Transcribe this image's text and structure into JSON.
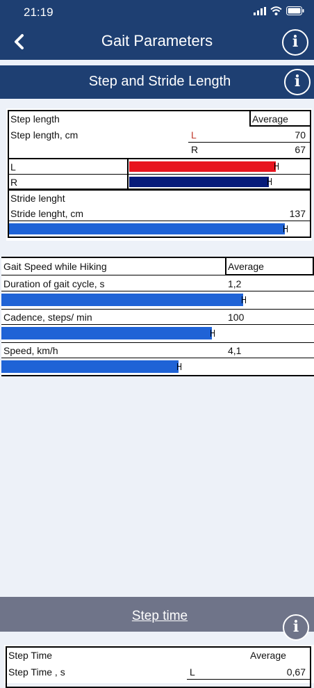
{
  "status_bar": {
    "time": "21:19"
  },
  "nav": {
    "title": "Gait Parameters"
  },
  "section": {
    "title": "Step and Stride Length"
  },
  "step_table": {
    "title": "Step length",
    "average_label": "Average",
    "unit_label": "Step length, cm",
    "left_label": "L",
    "right_label": "R",
    "left_value": "70",
    "right_value": "67",
    "left_bar_fill": 0.511,
    "right_bar_fill": 0.489,
    "left_color": "#e8141f",
    "right_color": "#071b7a"
  },
  "stride_table": {
    "title": "Stride lenght",
    "unit_label": "Stride lenght, cm",
    "value": "137",
    "bar_fill": 1.0
  },
  "gait_table": {
    "title": "Gait Speed while Hiking",
    "average_label": "Average",
    "rows": [
      {
        "label": "Duration of gait cycle, s",
        "value": "1,2",
        "bar_fill": 1.0
      },
      {
        "label": "Cadence, steps/ min",
        "value": "100",
        "bar_fill": 0.87
      },
      {
        "label": "Speed, km/h",
        "value": "4,1",
        "bar_fill": 0.734
      }
    ],
    "bar_color": "#1f63d6"
  },
  "footer": {
    "title": "Step time"
  },
  "step_time_table": {
    "title": "Step Time",
    "average_label": "Average",
    "unit_label": "Step Time , s",
    "left_label": "L",
    "left_value": "0,67"
  }
}
